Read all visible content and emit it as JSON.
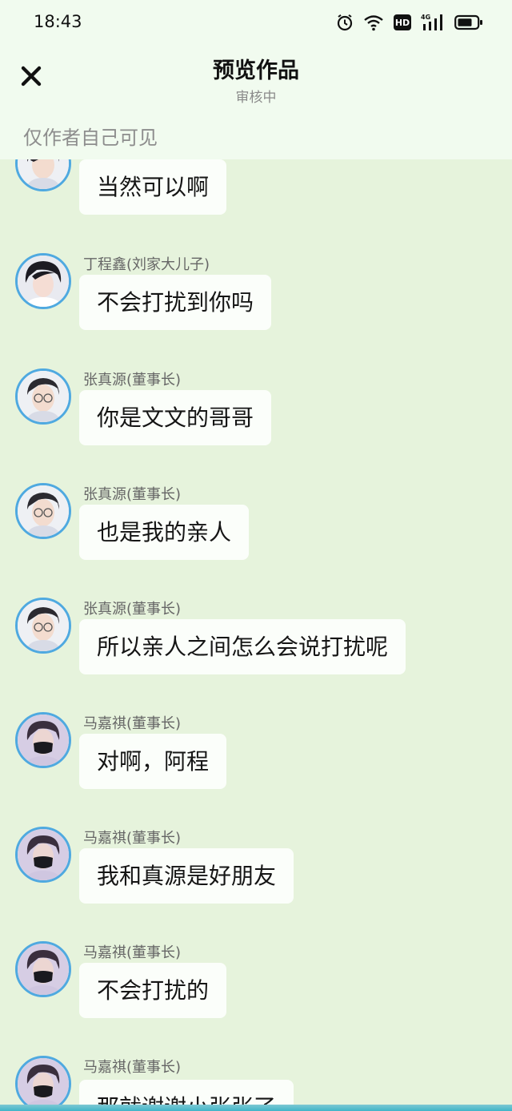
{
  "status_bar": {
    "time": "18:43",
    "icons": [
      "alarm-icon",
      "wifi-icon",
      "hd-icon",
      "signal-4g-icon",
      "battery-icon"
    ],
    "hd_label": "HD",
    "network_label": "4G"
  },
  "header": {
    "close_icon": "close-icon",
    "title": "预览作品",
    "subtitle": "审核中",
    "visibility_note": "仅作者自己可见"
  },
  "colors": {
    "header_bg": "#f1fbef",
    "chat_bg": "#e6f3dc",
    "bubble_bg": "#fbfefa",
    "avatar_ring": "#4fa9e0"
  },
  "messages": [
    {
      "sender": "",
      "text": "当然可以啊",
      "avatar": "avatar-zhang"
    },
    {
      "sender": "丁程鑫(刘家大儿子)",
      "text": "不会打扰到你吗",
      "avatar": "avatar-ding"
    },
    {
      "sender": "张真源(董事长)",
      "text": "你是文文的哥哥",
      "avatar": "avatar-zhang"
    },
    {
      "sender": "张真源(董事长)",
      "text": "也是我的亲人",
      "avatar": "avatar-zhang"
    },
    {
      "sender": "张真源(董事长)",
      "text": "所以亲人之间怎么会说打扰呢",
      "avatar": "avatar-zhang"
    },
    {
      "sender": "马嘉祺(董事长)",
      "text": "对啊，阿程",
      "avatar": "avatar-ma"
    },
    {
      "sender": "马嘉祺(董事长)",
      "text": "我和真源是好朋友",
      "avatar": "avatar-ma"
    },
    {
      "sender": "马嘉祺(董事长)",
      "text": "不会打扰的",
      "avatar": "avatar-ma"
    },
    {
      "sender": "马嘉祺(董事长)",
      "text": "那就谢谢小张张了",
      "avatar": "avatar-ma"
    }
  ]
}
